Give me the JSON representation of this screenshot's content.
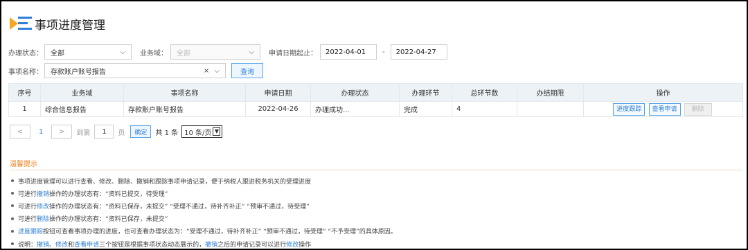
{
  "header": {
    "title": "事项进度管理",
    "logo_icon": "list-play-icon"
  },
  "filters": {
    "status_label": "办理状态：",
    "status_value": "全部",
    "domain_label": "业务域：",
    "domain_value": "全部",
    "date_label": "申请日期起止：",
    "date_from": "2022-04-01",
    "date_sep": "-",
    "date_to": "2022-04-27",
    "item_label": "事项名称：",
    "item_value": "存款账户账号报告",
    "clear_icon": "×",
    "query_label": "查询"
  },
  "table": {
    "headers": [
      "序号",
      "业务域",
      "事项名称",
      "申请日期",
      "办理状态",
      "办理环节",
      "总环节数",
      "办结期限",
      "操作"
    ],
    "rows": [
      {
        "index": "1",
        "domain": "综合信息报告",
        "name": "存款账户账号报告",
        "date": "2022-04-26",
        "status": "办理成功...",
        "stage": "完成",
        "total": "4",
        "deadline": "",
        "actions": {
          "track": "进度跟踪",
          "view": "查看申请",
          "delete": "删除"
        }
      }
    ]
  },
  "pager": {
    "prev": "<",
    "page": "1",
    "next": ">",
    "goto_label": "到第",
    "goto_value": "1",
    "page_unit": "页",
    "confirm": "确定",
    "total": "共 1 条",
    "size": "10 条/页"
  },
  "tips": {
    "title": "温馨提示",
    "accent_color": "#e8801f",
    "link_color": "#2e7fd7",
    "lines": [
      [
        {
          "t": "事项进度管理可以进行查看、修改、删除、撤销和跟踪事项申请记录，便于纳税人跟进税务机关的受理进度"
        }
      ],
      [
        {
          "t": "可进行"
        },
        {
          "t": "撤销",
          "k": 1
        },
        {
          "t": "操作的办理状态有：“资料已提交，待受理”"
        }
      ],
      [
        {
          "t": "可进行"
        },
        {
          "t": "修改",
          "k": 1
        },
        {
          "t": "操作的办理状态有：“资料已保存，未提交”  “受理不通过，待补齐补正”  “预审不通过，待受理”"
        }
      ],
      [
        {
          "t": "可进行"
        },
        {
          "t": "删除",
          "k": 1
        },
        {
          "t": "操作的办理状态有：“资料已保存，未提交”"
        }
      ],
      [
        {
          "t": "进度跟踪",
          "k": 1
        },
        {
          "t": "按钮可查看事项办理的进度，也可查看办理状态为：“受理不通过，待补齐补正”  “预审不通过，待受理”  “不予受理”的具体原因。"
        }
      ],
      [
        {
          "t": "说明："
        },
        {
          "t": "撤销",
          "k": 1
        },
        {
          "t": "、"
        },
        {
          "t": "修改",
          "k": 1
        },
        {
          "t": "和"
        },
        {
          "t": "查看申请",
          "k": 1
        },
        {
          "t": "三个按钮是根据事项状态动态展示的，"
        },
        {
          "t": "撤销",
          "k": 1
        },
        {
          "t": "之后的申请记录可以进行"
        },
        {
          "t": "修改",
          "k": 1
        },
        {
          "t": "操作"
        }
      ]
    ]
  }
}
